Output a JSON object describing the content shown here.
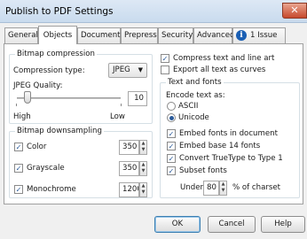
{
  "window": {
    "title": "Publish to PDF Settings",
    "close_glyph": "✕"
  },
  "tabs": [
    {
      "label": "General"
    },
    {
      "label": "Objects"
    },
    {
      "label": "Document"
    },
    {
      "label": "Prepress"
    },
    {
      "label": "Security"
    },
    {
      "label": "Advanced"
    },
    {
      "label": "1 Issue"
    }
  ],
  "bitmap_compression": {
    "title": "Bitmap compression",
    "compression_type_label": "Compression type:",
    "compression_type_value": "JPEG",
    "jpeg_quality_label": "JPEG Quality:",
    "jpeg_quality_value": "10",
    "jpeg_quality_fraction": 0.1,
    "slider_low_label": "High",
    "slider_high_label": "Low"
  },
  "bitmap_downsampling": {
    "title": "Bitmap downsampling",
    "rows": [
      {
        "label": "Color",
        "checked": true,
        "value": "350"
      },
      {
        "label": "Grayscale",
        "checked": true,
        "value": "350"
      },
      {
        "label": "Monochrome",
        "checked": true,
        "value": "1200"
      }
    ]
  },
  "options": {
    "compress_text": {
      "label": "Compress text and line art",
      "checked": true
    },
    "export_curves": {
      "label": "Export all text as curves",
      "checked": false
    }
  },
  "text_and_fonts": {
    "title": "Text and fonts",
    "encode_label": "Encode text as:",
    "ascii_label": "ASCII",
    "unicode_label": "Unicode",
    "selected": "Unicode",
    "embed_fonts": {
      "label": "Embed fonts in document",
      "checked": true
    },
    "embed_base14": {
      "label": "Embed base 14 fonts",
      "checked": true
    },
    "convert_truetype": {
      "label": "Convert TrueType to Type 1",
      "checked": true
    },
    "subset_fonts": {
      "label": "Subset fonts",
      "checked": true
    },
    "under_label": "Under",
    "under_value": "80",
    "percent_label": "% of charset"
  },
  "buttons": {
    "ok": "OK",
    "cancel": "Cancel",
    "help": "Help"
  },
  "icons": {
    "info": "info-icon"
  },
  "colors": {
    "accent": "#1a5fb4",
    "close": "#c7492d",
    "default_button": "#3c7fb1"
  }
}
